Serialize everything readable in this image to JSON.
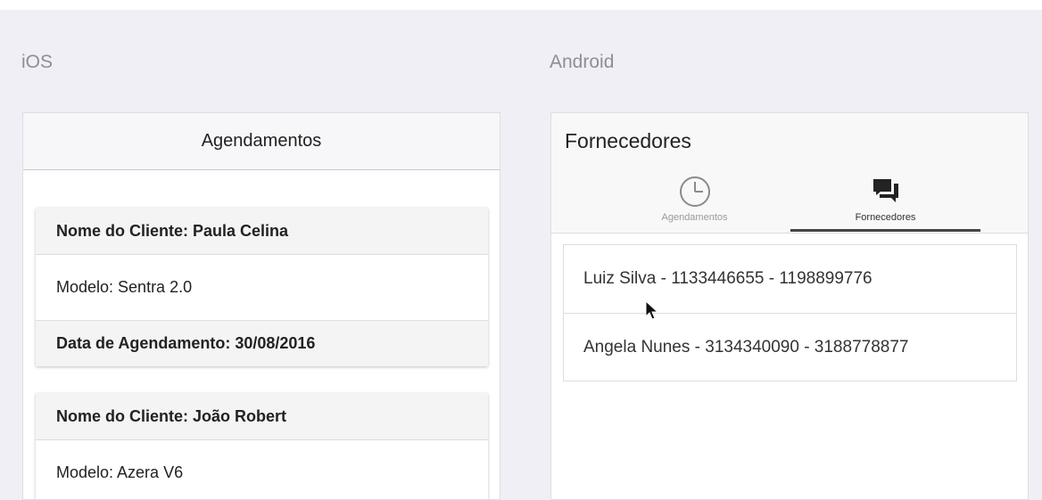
{
  "ios": {
    "platform_label": "iOS",
    "nav_title": "Agendamentos",
    "cards": [
      {
        "client": "Nome do Cliente: Paula Celina",
        "model": "Modelo: Sentra 2.0",
        "date": "Data de Agendamento: 30/08/2016"
      },
      {
        "client": "Nome do Cliente: João Robert",
        "model": "Modelo: Azera V6"
      }
    ]
  },
  "android": {
    "platform_label": "Android",
    "title": "Fornecedores",
    "tabs": [
      {
        "label": "Agendamentos",
        "icon": "clock-icon",
        "active": false
      },
      {
        "label": "Fornecedores",
        "icon": "chat-bubbles-icon",
        "active": true
      }
    ],
    "items": [
      "Luiz Silva - 1133446655 - 1198899776",
      "Angela Nunes - 3134340090 - 3188778877"
    ]
  },
  "colors": {
    "background": "#f0eff5",
    "label_gray": "#8e8e93",
    "tab_active": "#444444"
  }
}
